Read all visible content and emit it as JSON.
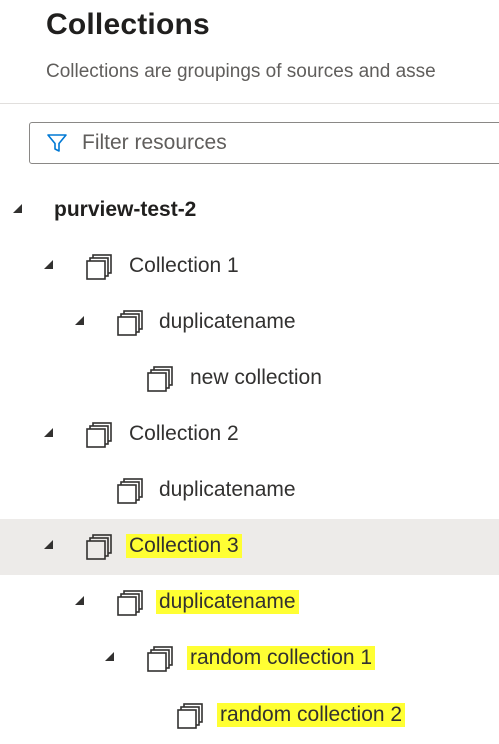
{
  "header": {
    "title": "Collections",
    "subtitle": "Collections are groupings of sources and asse"
  },
  "filter": {
    "placeholder": "Filter resources",
    "icon": "filter-icon"
  },
  "tree": {
    "root": {
      "label": "purview-test-2"
    },
    "items": [
      {
        "label": "Collection 1"
      },
      {
        "label": "duplicatename"
      },
      {
        "label": "new collection"
      },
      {
        "label": "Collection 2"
      },
      {
        "label": "duplicatename"
      },
      {
        "label": "Collection 3"
      },
      {
        "label": "duplicatename"
      },
      {
        "label": "random collection 1"
      },
      {
        "label": "random collection 2"
      }
    ]
  },
  "colors": {
    "highlight": "#ffff33",
    "selected_row": "#edebe9",
    "accent": "#0078d4"
  }
}
